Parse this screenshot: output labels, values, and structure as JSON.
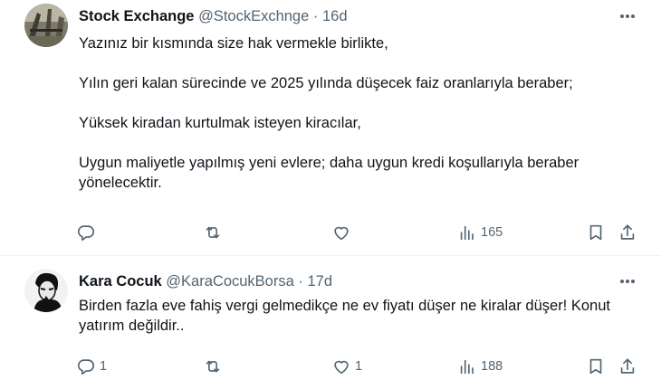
{
  "tweets": [
    {
      "name": "Stock Exchange",
      "handle": "@StockExchnge",
      "separator": "·",
      "time": "16d",
      "paragraphs": [
        "Yazınız bir kısmında size hak vermekle birlikte,",
        "Yılın geri kalan sürecinde ve 2025 yılında düşecek faiz oranlarıyla beraber;",
        "Yüksek kiradan kurtulmak isteyen kiracılar,",
        "Uygun maliyetle yapılmış yeni evlere; daha uygun kredi koşullarıyla beraber yönelecektir."
      ],
      "stats": {
        "replies": "",
        "reposts": "",
        "likes": "",
        "views": "165"
      }
    },
    {
      "name": "Kara Cocuk",
      "handle": "@KaraCocukBorsa",
      "separator": "·",
      "time": "17d",
      "paragraphs": [
        "Birden fazla eve fahiş vergi gelmedikçe ne ev fiyatı düşer ne kiralar düşer! Konut yatırım değildir.."
      ],
      "stats": {
        "replies": "1",
        "reposts": "",
        "likes": "1",
        "views": "188"
      }
    }
  ],
  "icons": {
    "reply": "reply-icon",
    "repost": "repost-icon",
    "like": "heart-icon",
    "views": "views-icon",
    "bookmark": "bookmark-icon",
    "share": "share-icon",
    "more": "more-icon"
  },
  "colors": {
    "text": "#0f1419",
    "secondary": "#536471",
    "divider": "#eff3f4"
  }
}
